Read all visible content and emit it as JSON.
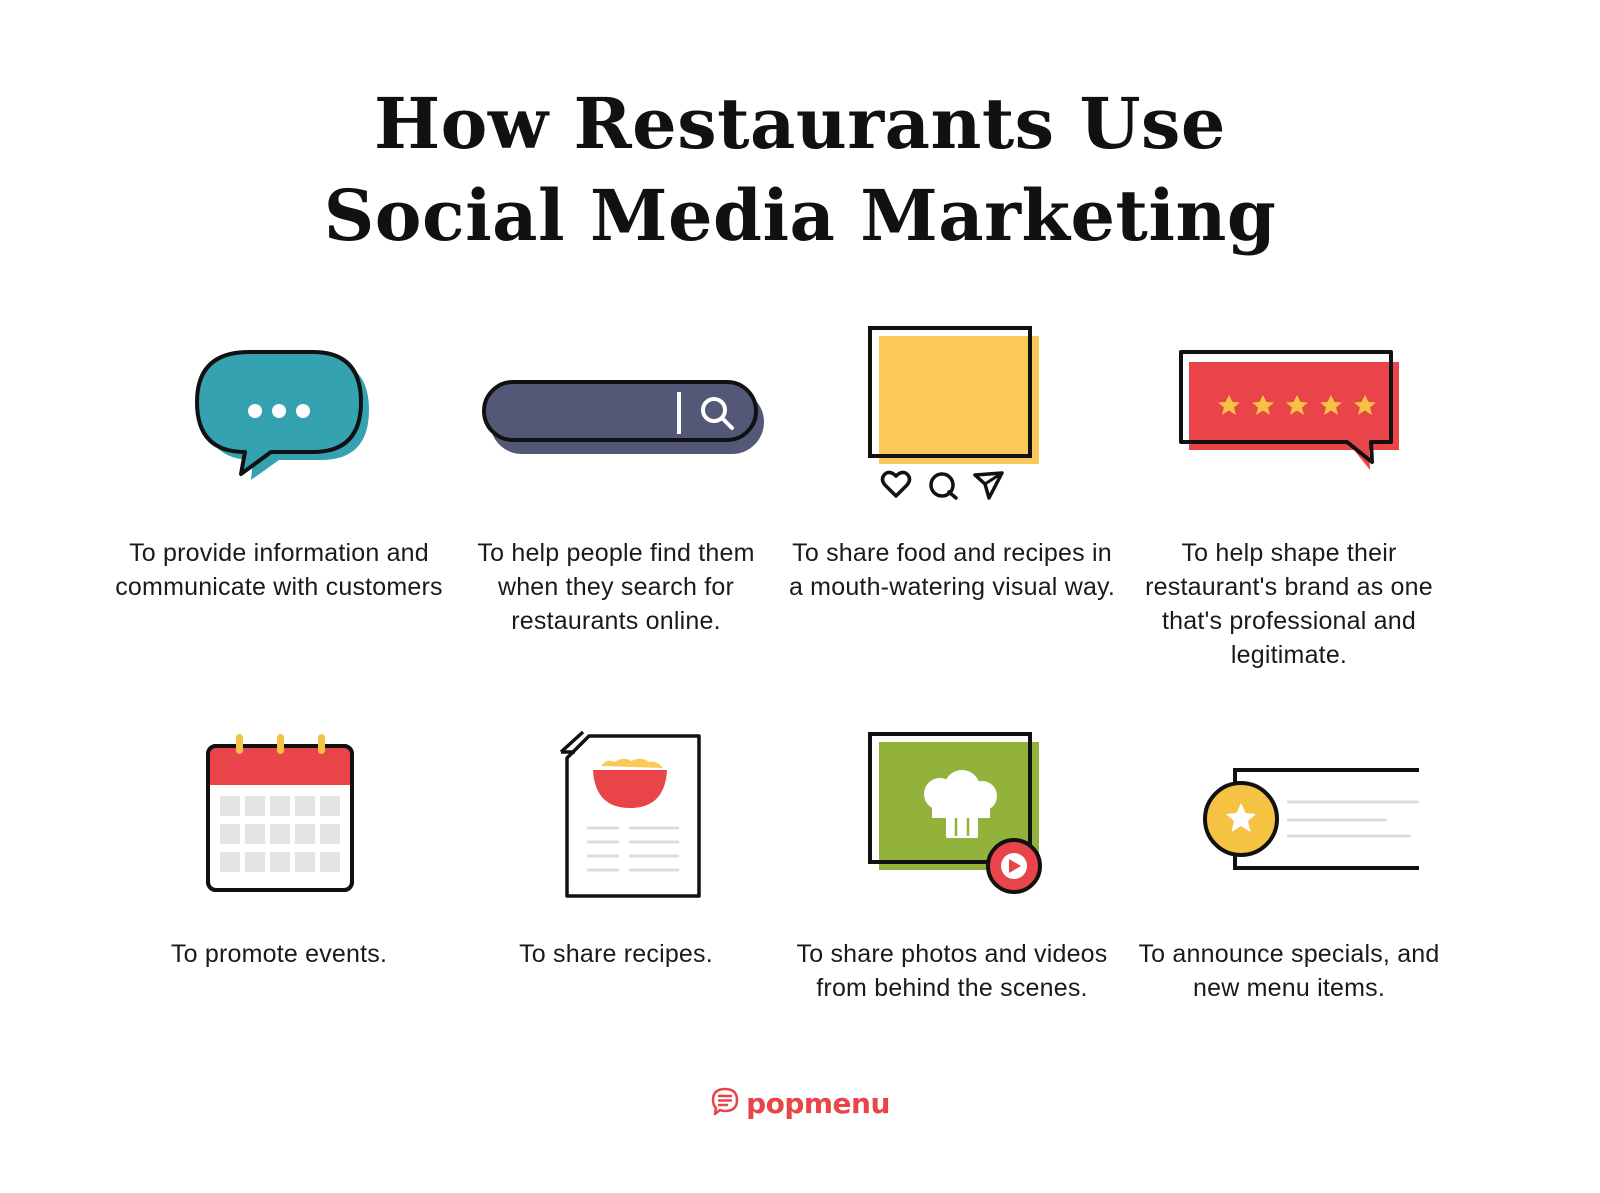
{
  "title": {
    "line1": "How Restaurants Use",
    "line2": "Social Media Marketing"
  },
  "colors": {
    "teal": "#35a2b2",
    "navy": "#535876",
    "yellow": "#fbc95a",
    "red": "#e8444a",
    "green": "#92b23c",
    "gold": "#f6c244",
    "dark": "#111111"
  },
  "items": [
    {
      "icon": "speech-bubble-icon",
      "text": "To provide information and communicate with customers"
    },
    {
      "icon": "search-bar-icon",
      "text": "To help people find them when they search for restaurants online."
    },
    {
      "icon": "photo-post-icon",
      "text": "To share food and recipes in a mouth-watering visual way."
    },
    {
      "icon": "star-review-icon",
      "text": "To help shape their restaurant's brand as one that's professional and legitimate."
    },
    {
      "icon": "calendar-icon",
      "text": "To promote events."
    },
    {
      "icon": "recipe-document-icon",
      "text": "To share recipes."
    },
    {
      "icon": "video-chef-hat-icon",
      "text": "To share photos and videos from behind the scenes."
    },
    {
      "icon": "special-badge-card-icon",
      "text": "To announce specials, and new menu items."
    }
  ],
  "logo": {
    "text": "popmenu",
    "icon": "popmenu-logo-icon"
  }
}
